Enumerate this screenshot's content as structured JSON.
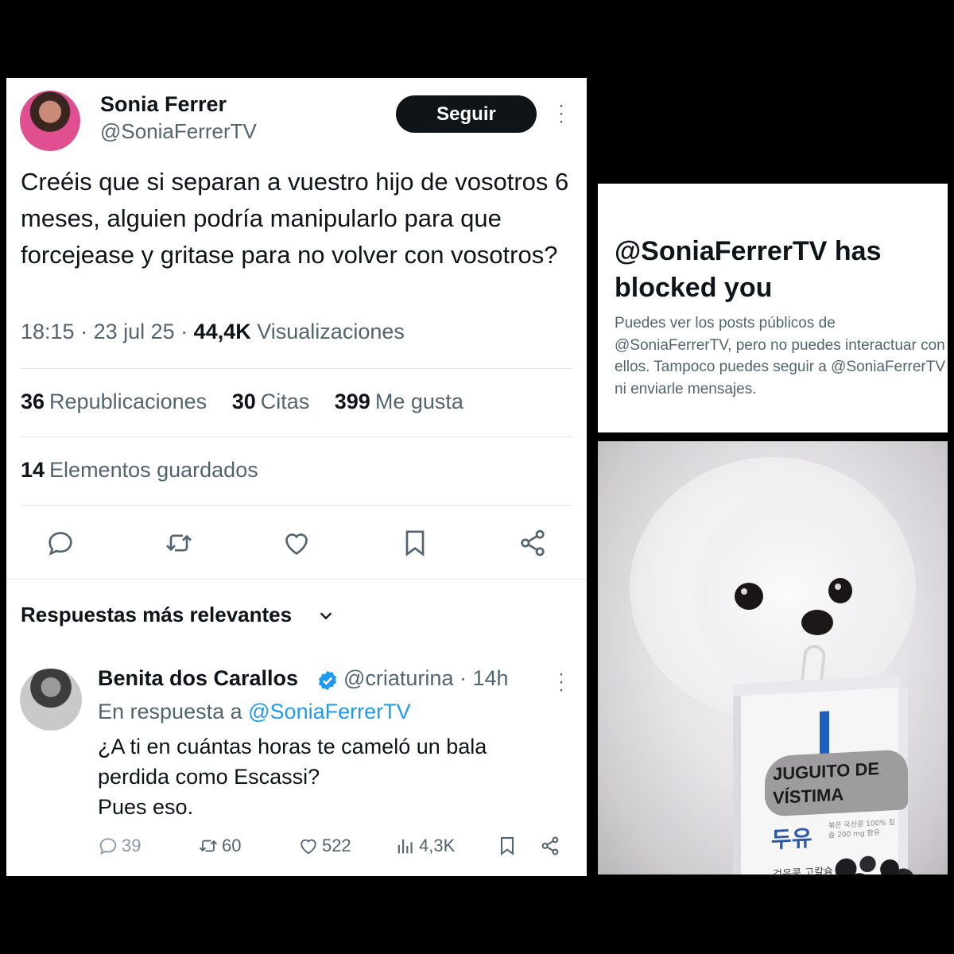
{
  "tweet": {
    "author_name": "Sonia Ferrer",
    "author_handle": "@SoniaFerrerTV",
    "follow_label": "Seguir",
    "text": "Creéis que si separan a vuestro hijo de vosotros 6 meses, alguien podría manipularlo para que forcejease y gritase para no volver con vosotros?",
    "time": "18:15",
    "date": "23 jul 25",
    "views_count": "44,4K",
    "views_label": "Visualizaciones",
    "reposts_count": "36",
    "reposts_label": "Republicaciones",
    "quotes_count": "30",
    "quotes_label": "Citas",
    "likes_count": "399",
    "likes_label": "Me gusta",
    "bookmarks_count": "14",
    "bookmarks_label": "Elementos guardados",
    "actions": [
      "reply-icon",
      "repost-icon",
      "like-icon",
      "bookmark-icon",
      "share-icon"
    ]
  },
  "replies": {
    "sort_label": "Respuestas más relevantes"
  },
  "reply": {
    "author_name": "Benita dos Carallos",
    "author_handle": "@criaturina",
    "time_ago": "14h",
    "in_reply_prefix": "En respuesta a",
    "in_reply_handle": "@SoniaFerrerTV",
    "text_line1": "¿A ti en cuántas horas te cameló un bala",
    "text_line2": "perdida como Escassi?",
    "text_line3": "Pues eso.",
    "replies_count": "39",
    "reposts_count": "60",
    "likes_count": "522",
    "views_count": "4,3K"
  },
  "blocked": {
    "title": "@SoniaFerrerTV has blocked you",
    "description": "Puedes ver los posts públicos de @SoniaFerrerTV, pero no puedes interactuar con ellos. Tampoco puedes seguir a @SoniaFerrerTV ni enviarle mensajes."
  },
  "meme": {
    "sticker_line1": "JUGUITO DE",
    "sticker_line2": "VÍSTIMA",
    "carton_brand": "두유",
    "carton_small": "볶은 국산콩 100%\n칼슘 200 mg 함유",
    "carton_bottom": "검은콩 고칼슘"
  },
  "colors": {
    "follow_bg": "#0f1419",
    "secondary_text": "#536471",
    "link": "#1d9bf0",
    "verified": "#1d9bf0"
  }
}
